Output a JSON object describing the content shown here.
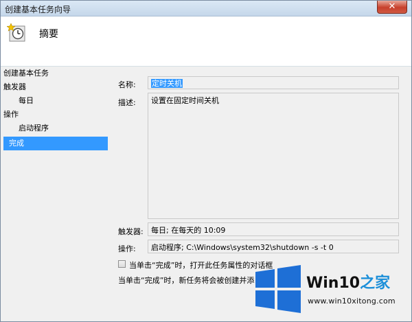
{
  "window": {
    "title": "创建基本任务向导",
    "close_glyph": "✕"
  },
  "header": {
    "icon": "task-clock-star-icon",
    "title": "摘要"
  },
  "nav": {
    "items": [
      {
        "label": "创建基本任务"
      },
      {
        "label": "触发器"
      },
      {
        "label": "每日"
      },
      {
        "label": "操作"
      },
      {
        "label": "启动程序"
      },
      {
        "label": "完成",
        "selected": true
      }
    ]
  },
  "form": {
    "name_label": "名称:",
    "name_value": "定时关机",
    "desc_label": "描述:",
    "desc_value": "设置在固定时间关机",
    "trigger_label": "触发器:",
    "trigger_value": "每日; 在每天的 10:09",
    "action_label": "操作:",
    "action_value": "启动程序; C:\\Windows\\system32\\shutdown -s -t 0",
    "open_props_label": "当单击“完成”时，打开此任务属性的对话框",
    "open_props_checked": false,
    "info_text": "当单击“完成”时，新任务将会被创建并添"
  },
  "watermark": {
    "brand_main": "Win10",
    "brand_accent": "之家",
    "url": "www.win10xitong.com",
    "colors": {
      "accent": "#1c8fd9",
      "logo_blue": "#1e6fd6"
    }
  }
}
